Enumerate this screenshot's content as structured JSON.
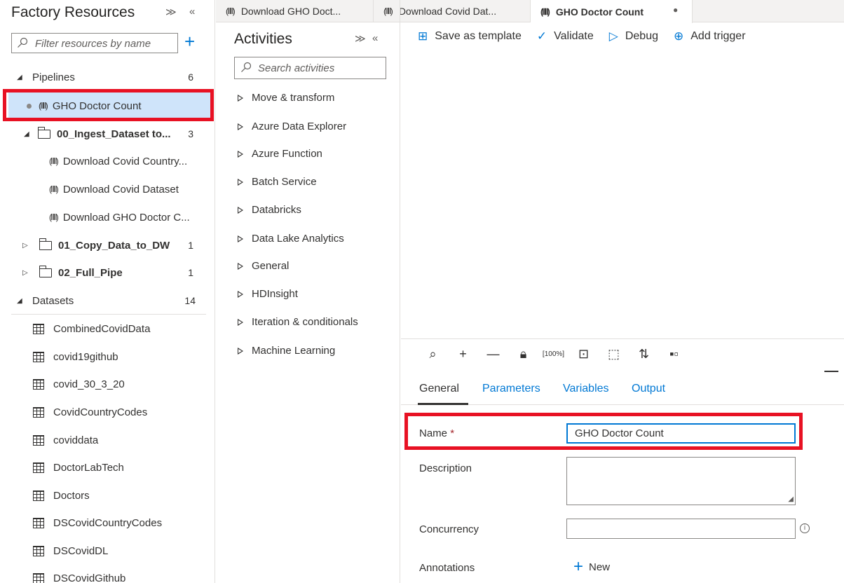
{
  "factory": {
    "title": "Factory Resources",
    "filter_placeholder": "Filter resources by name",
    "pipelines_label": "Pipelines",
    "pipelines_count": "6",
    "selected_pipeline": "GHO Doctor Count",
    "folders": [
      {
        "name": "00_Ingest_Dataset to...",
        "count": "3",
        "items": [
          "Download Covid Country...",
          "Download Covid Dataset",
          "Download GHO Doctor C..."
        ]
      },
      {
        "name": "01_Copy_Data_to_DW",
        "count": "1"
      },
      {
        "name": "02_Full_Pipe",
        "count": "1"
      }
    ],
    "datasets_label": "Datasets",
    "datasets_count": "14",
    "datasets": [
      "CombinedCovidData",
      "covid19github",
      "covid_30_3_20",
      "CovidCountryCodes",
      "coviddata",
      "DoctorLabTech",
      "Doctors",
      "DSCovidCountryCodes",
      "DSCovidDL",
      "DSCovidGithub"
    ]
  },
  "tabs": [
    {
      "label": "Download GHO Doct..."
    },
    {
      "label": "Download Covid Dat..."
    },
    {
      "label": "GHO Doctor Count"
    }
  ],
  "activities": {
    "title": "Activities",
    "search_placeholder": "Search activities",
    "categories": [
      "Move & transform",
      "Azure Data Explorer",
      "Azure Function",
      "Batch Service",
      "Databricks",
      "Data Lake Analytics",
      "General",
      "HDInsight",
      "Iteration & conditionals",
      "Machine Learning"
    ]
  },
  "toolbar": {
    "save_template": "Save as template",
    "validate": "Validate",
    "debug": "Debug",
    "add_trigger": "Add trigger"
  },
  "properties": {
    "tabs": [
      "General",
      "Parameters",
      "Variables",
      "Output"
    ],
    "name_label": "Name",
    "name_required": "*",
    "name_value": "GHO Doctor Count",
    "description_label": "Description",
    "concurrency_label": "Concurrency",
    "annotations_label": "Annotations",
    "new_label": "New"
  },
  "colors": {
    "accent": "#0078d4",
    "highlight": "#e81123",
    "selected": "#cfe4fa"
  }
}
